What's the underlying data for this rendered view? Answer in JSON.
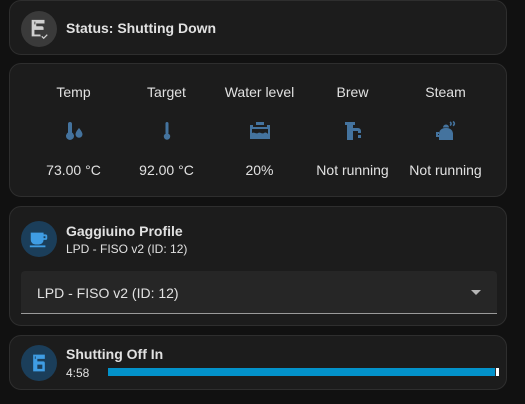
{
  "colors": {
    "accent": "#0392ca",
    "icon_blue": "#44739e",
    "card_bg": "#1c1c1c",
    "page_bg": "#111111"
  },
  "status": {
    "title": "Status: Shutting Down",
    "icon": "coffee-maker-check-icon"
  },
  "glance": {
    "items": [
      {
        "name": "Temp",
        "value": "73.00 °C",
        "icon": "thermometer-water-icon"
      },
      {
        "name": "Target",
        "value": "92.00 °C",
        "icon": "thermometer-icon"
      },
      {
        "name": "Water level",
        "value": "20%",
        "icon": "water-tank-icon"
      },
      {
        "name": "Brew",
        "value": "Not running",
        "icon": "water-pump-icon"
      },
      {
        "name": "Steam",
        "value": "Not running",
        "icon": "kettle-steam-icon"
      }
    ]
  },
  "profile": {
    "title": "Gaggiuino Profile",
    "subtitle": "LPD - FISO v2 (ID: 12)",
    "selected": "LPD - FISO v2 (ID: 12)",
    "icon": "coffee-cup-icon"
  },
  "timer": {
    "title": "Shutting Off In",
    "remaining": "4:58",
    "progress": 0.99,
    "icon": "coffee-maker-icon"
  }
}
